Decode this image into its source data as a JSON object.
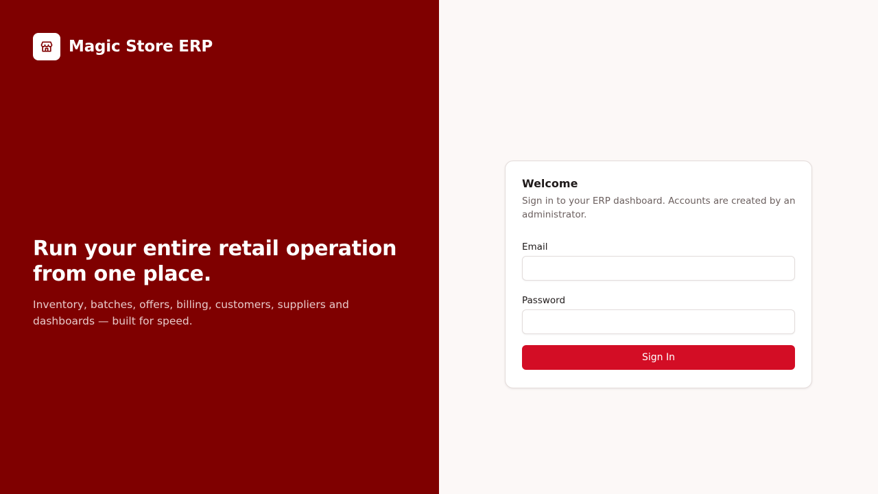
{
  "brand": {
    "name": "Magic Store ERP",
    "logo_icon": "storefront-icon"
  },
  "hero": {
    "title": "Run your entire retail operation from one place.",
    "subtitle": "Inventory, batches, offers, billing, customers, suppliers and dashboards — built for speed."
  },
  "login": {
    "title": "Welcome",
    "subtitle": "Sign in to your ERP dashboard. Accounts are created by an administrator.",
    "email_label": "Email",
    "email_value": "",
    "email_placeholder": "",
    "password_label": "Password",
    "password_value": "",
    "password_placeholder": "",
    "submit_label": "Sign In"
  },
  "colors": {
    "brand_panel": "#7f0000",
    "page_background": "#fcf8f7",
    "primary_button": "#d30d25"
  }
}
